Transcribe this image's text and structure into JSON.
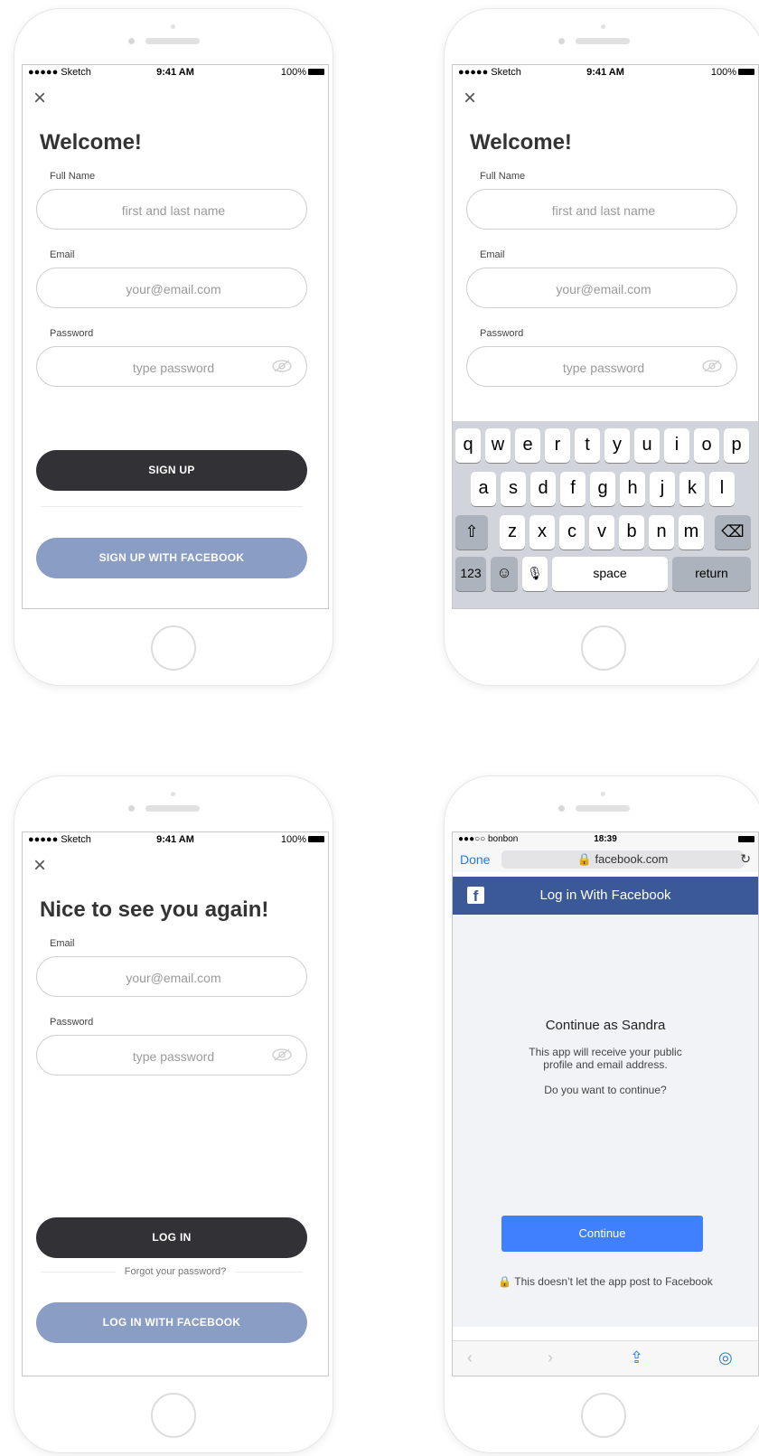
{
  "status": {
    "carrier": "●●●●● Sketch",
    "time": "9:41 AM",
    "battery": "100%"
  },
  "signup": {
    "title": "Welcome!",
    "full_name_label": "Full Name",
    "full_name_placeholder": "first and last name",
    "email_label": "Email",
    "email_placeholder": "your@email.com",
    "password_label": "Password",
    "password_placeholder": "type password",
    "signup_button": "SIGN UP",
    "facebook_button": "SIGN UP WITH FACEBOOK"
  },
  "keyboard": {
    "row1": [
      "q",
      "w",
      "e",
      "r",
      "t",
      "y",
      "u",
      "i",
      "o",
      "p"
    ],
    "row2": [
      "a",
      "s",
      "d",
      "f",
      "g",
      "h",
      "j",
      "k",
      "l"
    ],
    "row3": [
      "z",
      "x",
      "c",
      "v",
      "b",
      "n",
      "m"
    ],
    "shift_icon": "⇧",
    "delete_icon": "⌫",
    "numbers": "123",
    "emoji_icon": "☺",
    "mic_icon": "🎙",
    "space": "space",
    "return": "return"
  },
  "login": {
    "title": "Nice to see you again!",
    "email_label": "Email",
    "email_placeholder": "your@email.com",
    "password_label": "Password",
    "password_placeholder": "type password",
    "login_button": "LOG IN",
    "forgot": "Forgot your password?",
    "facebook_button": "LOG IN WITH FACEBOOK"
  },
  "facebook": {
    "status_carrier": "●●●○○ bonbon",
    "status_time": "18:39",
    "done": "Done",
    "url": "facebook.com",
    "header": "Log in With Facebook",
    "logo": "f",
    "continue_title": "Continue as Sandra",
    "info_line1": "This app will receive your public",
    "info_line2": "profile and email address.",
    "question": "Do you want to continue?",
    "continue_button": "Continue",
    "no_post": "This doesn’t let the app post to Facebook"
  },
  "colors": {
    "dark_button": "#323236",
    "fb_button": "#8a9dc4",
    "fb_brand": "#3b5998",
    "continue_blue": "#4080ff",
    "ios_blue": "#1e7cf2"
  }
}
